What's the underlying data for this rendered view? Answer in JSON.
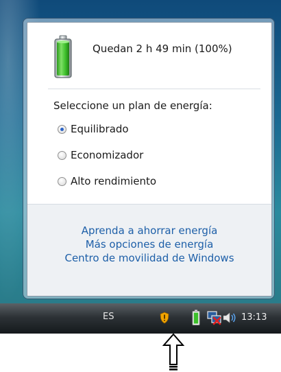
{
  "flyout": {
    "status_text": "Quedan 2 h 49 min (100%)",
    "battery_percent": 100,
    "plans_title": "Seleccione un plan de energía:",
    "plans": [
      {
        "label": "Equilibrado",
        "selected": true
      },
      {
        "label": "Economizador",
        "selected": false
      },
      {
        "label": "Alto rendimiento",
        "selected": false
      }
    ],
    "links": [
      "Aprenda a ahorrar energía",
      "Más opciones de energía",
      "Centro de movilidad de Windows"
    ]
  },
  "taskbar": {
    "language": "ES",
    "clock": "13:13",
    "icons": [
      "shield-icon",
      "battery-icon",
      "network-icon",
      "volume-icon"
    ]
  },
  "colors": {
    "link": "#1d5fa8",
    "battery_green": "#3cbf2a",
    "radio_selected": "#2a63c6"
  },
  "annotation": {
    "icon": "up-arrow-icon"
  }
}
